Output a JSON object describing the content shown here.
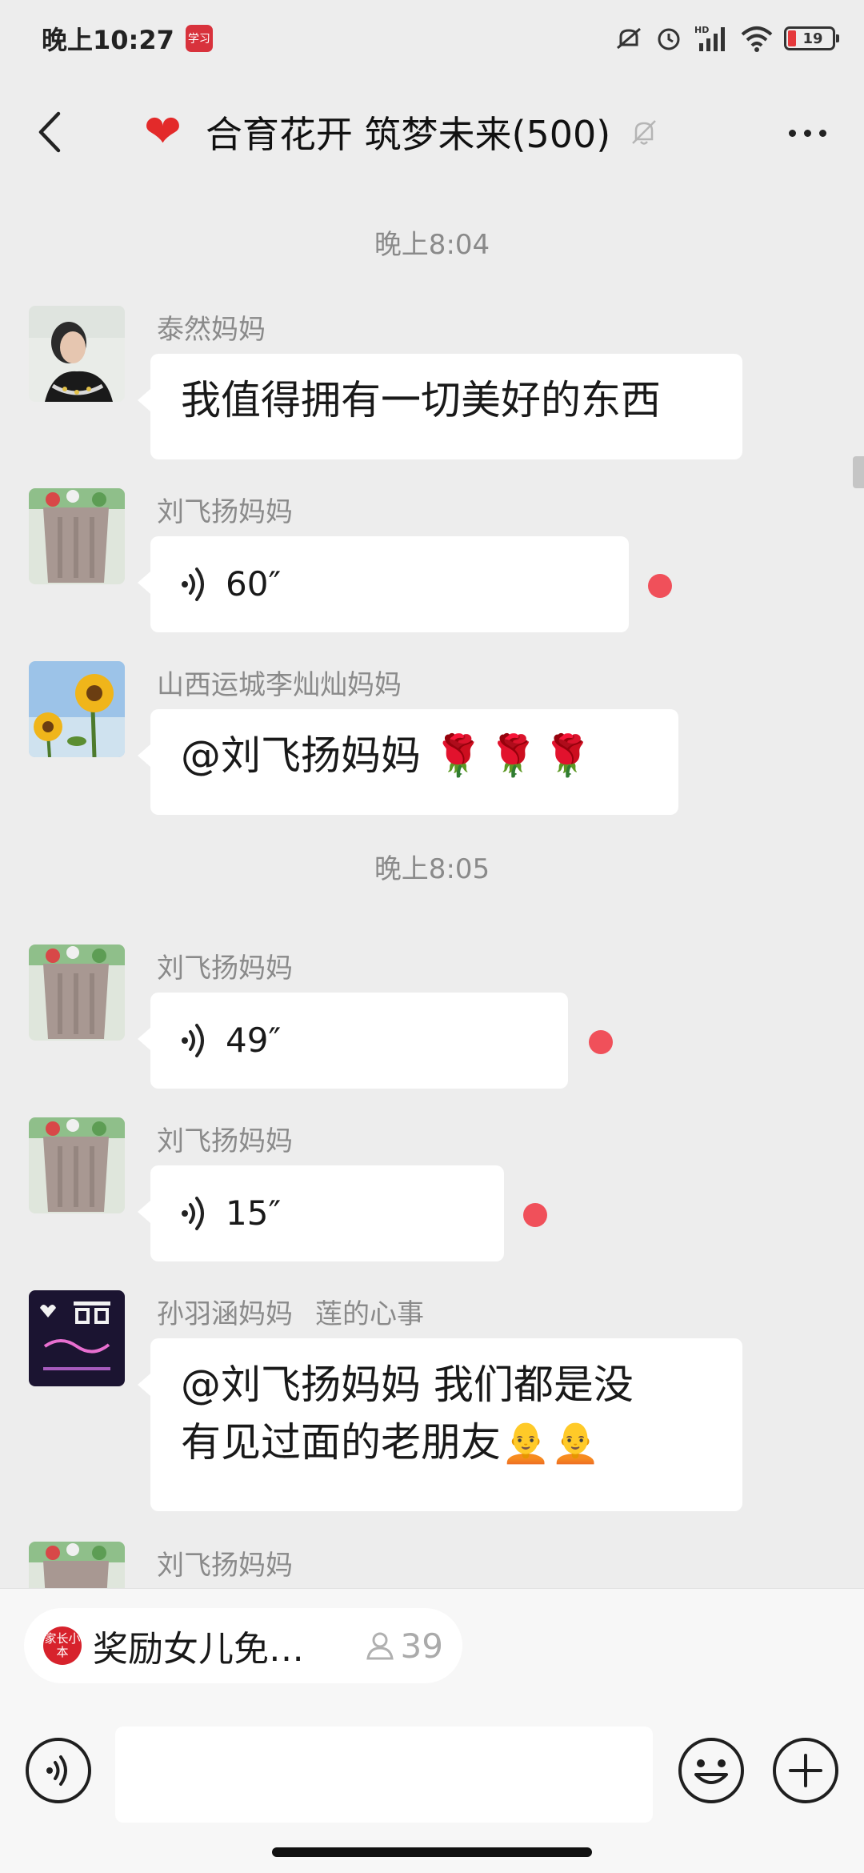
{
  "status_bar": {
    "time": "晚上10:27",
    "app_badge": "学习",
    "hd_label": "HD",
    "battery_level": "19"
  },
  "header": {
    "title": "合育花开 筑梦未来(500)",
    "back_icon": "chevron-left-icon",
    "title_icon": "heart-icon",
    "mute_icon": "bell-off-icon",
    "more_icon": "more-dots-icon"
  },
  "messages": {
    "time_1": "晚上8:04",
    "time_2": "晚上8:05",
    "m1": {
      "sender": "泰然妈妈",
      "text": "我值得拥有一切美好的东西"
    },
    "m2": {
      "sender": "刘飞扬妈妈",
      "duration": "60″",
      "unread": true
    },
    "m3": {
      "sender": "山西运城李灿灿妈妈",
      "text": "@刘飞扬妈妈 ",
      "emoji": "🌹🌹🌹"
    },
    "m4": {
      "sender": "刘飞扬妈妈",
      "duration": "49″",
      "unread": true
    },
    "m5": {
      "sender": "刘飞扬妈妈",
      "duration": "15″",
      "unread": true
    },
    "m6": {
      "sender": "孙羽涵妈妈",
      "sender_extra": "莲的心事",
      "text_line1": "@刘飞扬妈妈  我们都是没",
      "text_line2": "有见过面的老朋友",
      "emoji": "🧑‍🦲🧑‍🦲"
    },
    "m7": {
      "sender": "刘飞扬妈妈"
    }
  },
  "notice": {
    "logo": "家长小本",
    "text": "奖励女儿免…",
    "count": "39"
  },
  "input": {
    "placeholder": ""
  },
  "colors": {
    "background": "#ededed",
    "bubble": "#ffffff",
    "unread_dot": "#f0505a",
    "heart": "#e32a2a"
  }
}
